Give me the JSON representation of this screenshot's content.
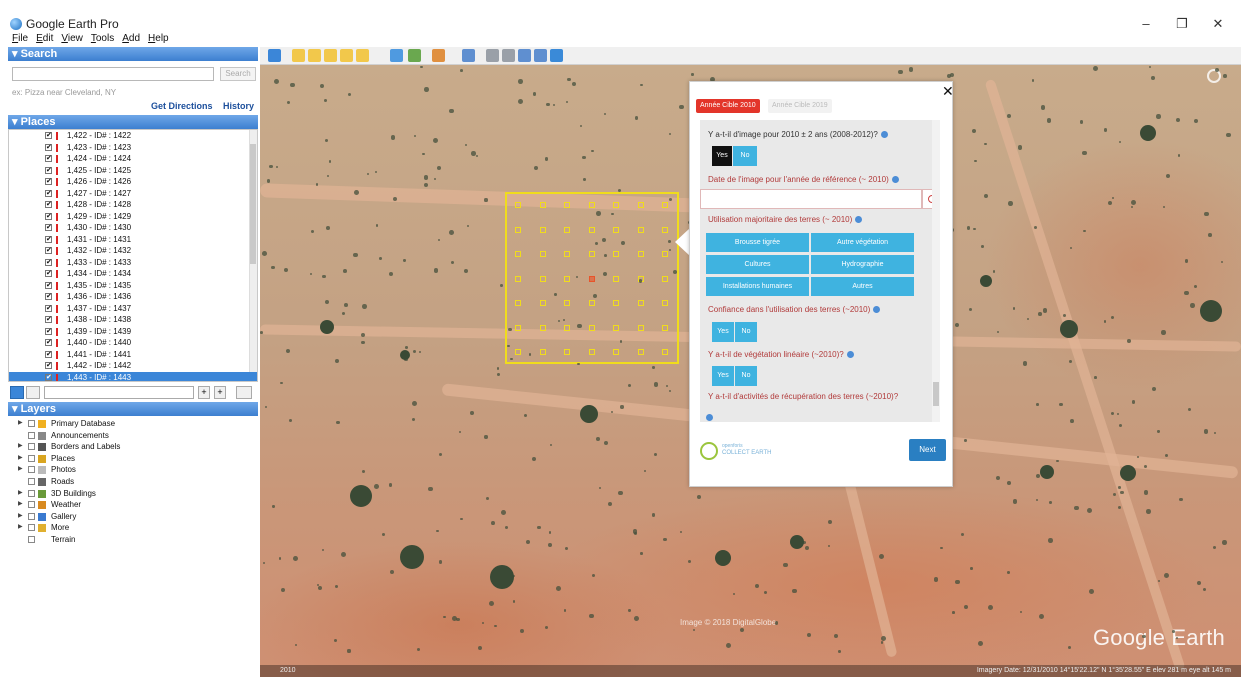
{
  "window": {
    "title": "Google Earth Pro",
    "minimize": "–",
    "restore": "❐",
    "close": "✕"
  },
  "menu": [
    {
      "key": "F",
      "rest": "ile"
    },
    {
      "key": "E",
      "rest": "dit"
    },
    {
      "key": "V",
      "rest": "iew"
    },
    {
      "key": "T",
      "rest": "ools"
    },
    {
      "key": "A",
      "rest": "dd"
    },
    {
      "key": "H",
      "rest": "elp"
    }
  ],
  "search": {
    "header": "▾ Search",
    "button": "Search",
    "hint": "ex: Pizza near Cleveland, NY",
    "get_directions": "Get Directions",
    "history": "History"
  },
  "places": {
    "header": "▾ Places",
    "items": [
      "1,422 - ID# : 1422",
      "1,423 - ID# : 1423",
      "1,424 - ID# : 1424",
      "1,425 - ID# : 1425",
      "1,426 - ID# : 1426",
      "1,427 - ID# : 1427",
      "1,428 - ID# : 1428",
      "1,429 - ID# : 1429",
      "1,430 - ID# : 1430",
      "1,431 - ID# : 1431",
      "1,432 - ID# : 1432",
      "1,433 - ID# : 1433",
      "1,434 - ID# : 1434",
      "1,435 - ID# : 1435",
      "1,436 - ID# : 1436",
      "1,437 - ID# : 1437",
      "1,438 - ID# : 1438",
      "1,439 - ID# : 1439",
      "1,440 - ID# : 1440",
      "1,441 - ID# : 1441",
      "1,442 - ID# : 1442",
      "1,443 - ID# : 1443"
    ],
    "selected_index": 21,
    "check": "✔"
  },
  "layers": {
    "header": "▾ Layers",
    "items": [
      {
        "label": "Primary Database",
        "expandable": true,
        "color": "#f0b020"
      },
      {
        "label": "Announcements",
        "expandable": false,
        "color": "#888888"
      },
      {
        "label": "Borders and Labels",
        "expandable": true,
        "color": "#555555"
      },
      {
        "label": "Places",
        "expandable": true,
        "color": "#d9a520"
      },
      {
        "label": "Photos",
        "expandable": true,
        "color": "#bbbbbb"
      },
      {
        "label": "Roads",
        "expandable": false,
        "color": "#666666"
      },
      {
        "label": "3D Buildings",
        "expandable": true,
        "color": "#6a9a3a"
      },
      {
        "label": "Weather",
        "expandable": true,
        "color": "#d88a20"
      },
      {
        "label": "Gallery",
        "expandable": true,
        "color": "#3a7ad0"
      },
      {
        "label": "More",
        "expandable": true,
        "color": "#e0b030"
      },
      {
        "label": "Terrain",
        "expandable": false,
        "color": "#ffffff"
      }
    ]
  },
  "map": {
    "watermark": "Google Earth",
    "copyright": "Image © 2018 DigitalGlobe",
    "status_left": "2010",
    "status_right": "Imagery Date: 12/31/2010    14°15'22.12\" N    1°35'28.55\" E    elev 281 m    eye alt 145 m"
  },
  "collect_earth": {
    "close": "✕",
    "tab_active": "Année Cible 2010",
    "tab_inactive": "Année Cible 2019",
    "q1": "Y a-t-il d'image pour 2010 ± 2 ans (2008-2012)?",
    "yes": "Yes",
    "no": "No",
    "q2": "Date de l'image pour l'année de référence (~ 2010)",
    "q3": "Utilisation majoritaire des terres (~ 2010)",
    "options": [
      "Brousse tigrée",
      "Autre végétation",
      "Cultures",
      "Hydrographie",
      "Installations humaines",
      "Autres"
    ],
    "q4": "Confiance dans l'utilisation des terres (~2010)",
    "q5": "Y a-t-il de végétation linéaire (~2010)?",
    "q6": "Y a-t-il d'activités de récupération des terres (~2010)?",
    "logo_line1": "openforis",
    "logo_line2": "COLLECT EARTH",
    "next": "Next"
  },
  "colors": {
    "accent": "#3fb3e0",
    "tab_red": "#e3352a",
    "grid_yellow": "#f0dc1c",
    "panel_blue": "#3c7fd0"
  }
}
